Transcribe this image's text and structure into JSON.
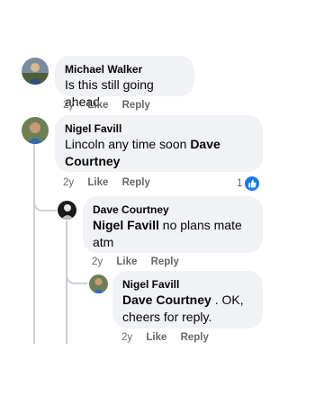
{
  "comments": [
    {
      "author": "Michael Walker",
      "text": "Is this still going ahead",
      "time": "2y",
      "like_label": "Like",
      "reply_label": "Reply"
    },
    {
      "author": "Nigel Favill",
      "text": "Lincoln any time soon ",
      "mention": "Dave Courtney",
      "time": "2y",
      "like_label": "Like",
      "reply_label": "Reply",
      "reaction_count": "1",
      "reaction_icon": "thumbs-up-icon",
      "replies": [
        {
          "author": "Dave Courtney",
          "mention": "Nigel Favill",
          "text": " no plans mate atm",
          "time": "2y",
          "like_label": "Like",
          "reply_label": "Reply"
        },
        {
          "author": "Nigel Favill",
          "mention": "Dave Courtney",
          "text": " . OK, cheers for reply.",
          "time": "2y",
          "like_label": "Like",
          "reply_label": "Reply"
        }
      ]
    }
  ],
  "colors": {
    "bubble": "#f0f2f5",
    "meta": "#65676b",
    "reaction": "#1877f2",
    "thread_line": "#ccd0d5"
  }
}
